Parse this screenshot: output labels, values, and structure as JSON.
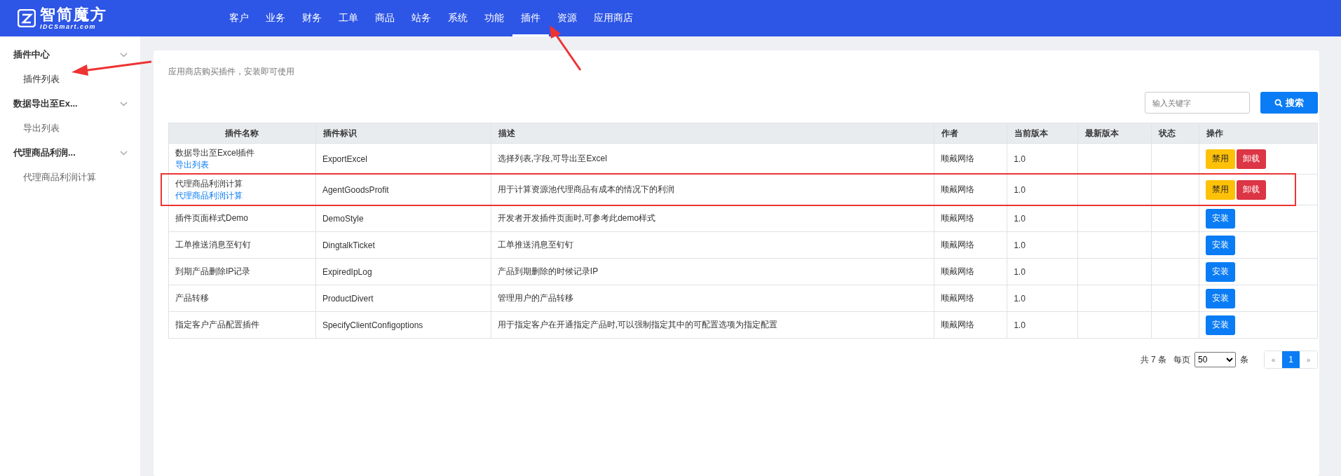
{
  "logo": {
    "title": "智简魔方",
    "subtitle": "IDCSmart.com"
  },
  "nav": [
    {
      "label": "客户",
      "selected": false
    },
    {
      "label": "业务",
      "selected": false
    },
    {
      "label": "财务",
      "selected": false
    },
    {
      "label": "工单",
      "selected": false
    },
    {
      "label": "商品",
      "selected": false
    },
    {
      "label": "站务",
      "selected": false
    },
    {
      "label": "系统",
      "selected": false
    },
    {
      "label": "功能",
      "selected": false
    },
    {
      "label": "插件",
      "selected": true
    },
    {
      "label": "资源",
      "selected": false
    },
    {
      "label": "应用商店",
      "selected": false
    }
  ],
  "sidebar": {
    "groups": [
      {
        "title": "插件中心",
        "expanded": true,
        "items": [
          {
            "label": "插件列表",
            "selected": true
          }
        ]
      },
      {
        "title": "数据导出至Ex...",
        "expanded": true,
        "items": [
          {
            "label": "导出列表",
            "selected": false
          }
        ]
      },
      {
        "title": "代理商品利润...",
        "expanded": true,
        "items": [
          {
            "label": "代理商品利润计算",
            "selected": false
          }
        ]
      }
    ]
  },
  "notice": "应用商店购买插件，安装即可使用",
  "search": {
    "placeholder": "输入关键字",
    "button": "搜索"
  },
  "table": {
    "columns": [
      "插件名称",
      "插件标识",
      "描述",
      "作者",
      "当前版本",
      "最新版本",
      "状态",
      "操作"
    ],
    "rows": [
      {
        "name": "数据导出至Excel插件",
        "link": "导出列表",
        "id": "ExportExcel",
        "description": "选择列表,字段,可导出至Excel",
        "author": "顺戴网络",
        "version": "1.0",
        "highlighted": false,
        "actions": [
          {
            "kind": "disable",
            "label": "禁用"
          },
          {
            "kind": "uninstall",
            "label": "卸载"
          }
        ]
      },
      {
        "name": "代理商品利润计算",
        "link": "代理商品利润计算",
        "id": "AgentGoodsProfit",
        "description": "用于计算资源池代理商品有成本的情况下的利润",
        "author": "顺戴网络",
        "version": "1.0",
        "highlighted": true,
        "actions": [
          {
            "kind": "disable",
            "label": "禁用"
          },
          {
            "kind": "uninstall",
            "label": "卸载"
          }
        ]
      },
      {
        "name": "插件页面样式Demo",
        "id": "DemoStyle",
        "description": "开发者开发插件页面时,可参考此demo样式",
        "author": "顺戴网络",
        "version": "1.0",
        "highlighted": false,
        "actions": [
          {
            "kind": "install",
            "label": "安装"
          }
        ]
      },
      {
        "name": "工单推送消息至钉钉",
        "id": "DingtalkTicket",
        "description": "工单推送消息至钉钉",
        "author": "顺戴网络",
        "version": "1.0",
        "highlighted": false,
        "actions": [
          {
            "kind": "install",
            "label": "安装"
          }
        ]
      },
      {
        "name": "到期产品删除IP记录",
        "id": "ExpiredIpLog",
        "description": "产品到期删除的时候记录IP",
        "author": "顺戴网络",
        "version": "1.0",
        "highlighted": false,
        "actions": [
          {
            "kind": "install",
            "label": "安装"
          }
        ]
      },
      {
        "name": "产品转移",
        "id": "ProductDivert",
        "description": "管理用户的产品转移",
        "author": "顺戴网络",
        "version": "1.0",
        "highlighted": false,
        "actions": [
          {
            "kind": "install",
            "label": "安装"
          }
        ]
      },
      {
        "name": "指定客户产品配置插件",
        "id": "SpecifyClientConfigoptions",
        "description": "用于指定客户在开通指定产品时,可以强制指定其中的可配置选项为指定配置",
        "author": "顺戴网络",
        "version": "1.0",
        "highlighted": false,
        "actions": [
          {
            "kind": "install",
            "label": "安装"
          }
        ]
      }
    ]
  },
  "pagination": {
    "total": "共 7 条",
    "per_page_label": "每页",
    "per_page": "50",
    "unit": "条",
    "prev": "«",
    "pages": [
      {
        "label": "1",
        "selected": true
      }
    ],
    "next": "»"
  }
}
